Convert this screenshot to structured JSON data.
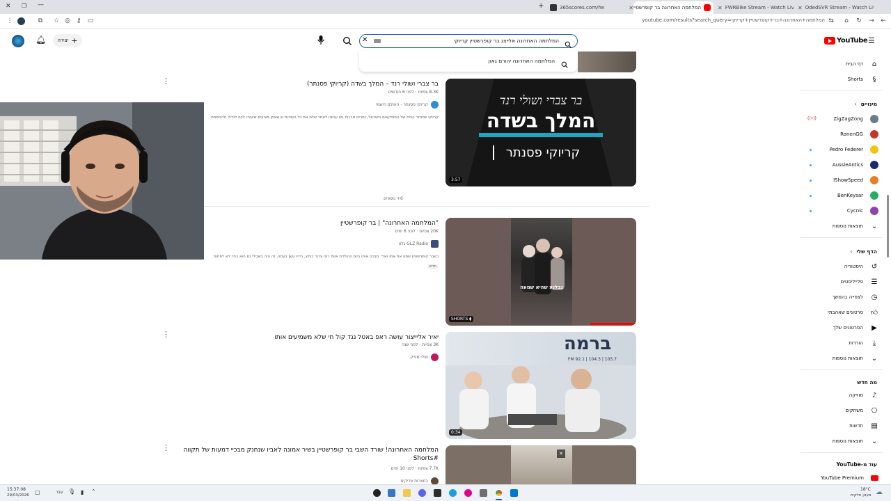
{
  "browser": {
    "tabs": [
      {
        "title": "365scores.com/he",
        "icon_color": "#3a3a3a"
      },
      {
        "title": "המלחמה האחרונה בר קופרשטיין",
        "icon_color": "#ff0000"
      },
      {
        "title": "FWRBike Stream - Watch Live",
        "icon_color": "#1db954"
      },
      {
        "title": "OdedSVR Stream - Watch Live",
        "icon_color": "#53fc18"
      }
    ],
    "url": "youtube.com/results?search_query=המלחמה+האחרונה+בר+קופרשטיין+קריוקי"
  },
  "youtube": {
    "logo_text": "YouTube",
    "search_value": "המלחמה האחרונה אלייצג בר קופרשטיין קריוקי",
    "suggestion": "המלחמה האחרונה יהורם גאון",
    "create_label": "יצירה"
  },
  "sidebar": {
    "top": [
      {
        "label": "דף הבית",
        "icon": "home-icon"
      },
      {
        "label": "Shorts",
        "icon": "shorts-icon"
      }
    ],
    "subs_title": "מינויים",
    "subs": [
      {
        "label": "ZigZagZong",
        "color": "#6b7b8c",
        "live": true
      },
      {
        "label": "RonenGG",
        "color": "#c0392b",
        "live": false
      },
      {
        "label": "Pedro Federer",
        "color": "#f1c40f",
        "live": false
      },
      {
        "label": "AussieAntics",
        "color": "#1a2a6c",
        "live": false
      },
      {
        "label": "IShowSpeed",
        "color": "#e67e22",
        "live": false
      },
      {
        "label": "BenKeysar",
        "color": "#27ae60",
        "live": false
      },
      {
        "label": "Cycnic",
        "color": "#8e44ad",
        "live": false
      }
    ],
    "more_label": "תוצאות נוספות",
    "you_title": "הדף שלי",
    "you": [
      {
        "label": "היסטוריה",
        "icon": "history-icon"
      },
      {
        "label": "פלייליסטים",
        "icon": "playlists-icon"
      },
      {
        "label": "לצפייה בהמשך",
        "icon": "watch-later-icon"
      },
      {
        "label": "סרטונים שאהבתי",
        "icon": "like-icon"
      },
      {
        "label": "הסרטונים שלך",
        "icon": "your-videos-icon"
      },
      {
        "label": "הורדות",
        "icon": "downloads-icon"
      },
      {
        "label": "תוצאות נוספות",
        "icon": "chevron-down-icon"
      }
    ],
    "explore_title": "מה חדש",
    "explore": [
      {
        "label": "מוזיקה",
        "icon": "music-icon"
      },
      {
        "label": "משחקים",
        "icon": "gaming-icon"
      },
      {
        "label": "חדשות",
        "icon": "news-icon"
      },
      {
        "label": "תוצאות נוספות",
        "icon": "chevron-down-icon"
      }
    ],
    "more_from_title": "עוד מ-YouTube",
    "premium_label": "YouTube Premium"
  },
  "results": [
    {
      "title": "בר צברי ושולי רנד – המלך בשדה (קריוקי פסנתר)",
      "meta": "8.3K צפיות · לפני 6 חודשים",
      "channel": "קריוקי פסנתר - העולם הישמי",
      "desc": "קריוקי פסנתר הבית של המוזיקאים בישראל, זמרים חברות גלו עכשיו לאתר שלנו את כל השירות ש שאתן מציעים שיעזרו לכם לגדול ולהתפתח",
      "duration": "3:57",
      "more": "6+ נוספים",
      "thumb_line1": "בר צברי ושולי רנד",
      "thumb_line2": "המלך בשדה",
      "thumb_line3": "קריוקי פסנתר"
    },
    {
      "title": "\"המלחמה האחרונה\" | בר קופרשטיין",
      "meta": "20K צפיות · לפני 6 ימים",
      "channel": "GLZ Radio גלצ",
      "desc": "כשבר קופרשטיין שמע את אמו גאל׳ מבכה אותו ביום ההולדת אשל רונו צרור בגלצ, בידיו עשן בעתה, זה היה בשבילי גם הוא בחר לא לפחות",
      "badge": "חדש",
      "duration": "SHORTS",
      "thumb_caption": "נבלנע שהיא שמעה"
    },
    {
      "title": "יאיר אליייצור עושה ראפ באטל נגד קול חי שלא משמיעים אותו",
      "meta": "3K צפיות · לפני שנה",
      "channel": "מולי מנייק",
      "duration": "0:34",
      "thumb_sign": "ברמה",
      "thumb_freq": "FM 92.1 | 104.3 | 105.7"
    },
    {
      "title": "המלחמה האחרונה! שורד השבי בר קופרשטיין בשיר אמונה לאביו שנחנק מבכיי דמעות של תקווה #Shorts",
      "meta": "7.7K צפיות · לפני 10 ימים",
      "channel": "בחצרות צדיקים"
    }
  ],
  "taskbar": {
    "time": "15:37:08",
    "date": "29/03/2026",
    "lang": "עבר",
    "weather": "18°C",
    "weather_text": "מעונן חלקית"
  }
}
